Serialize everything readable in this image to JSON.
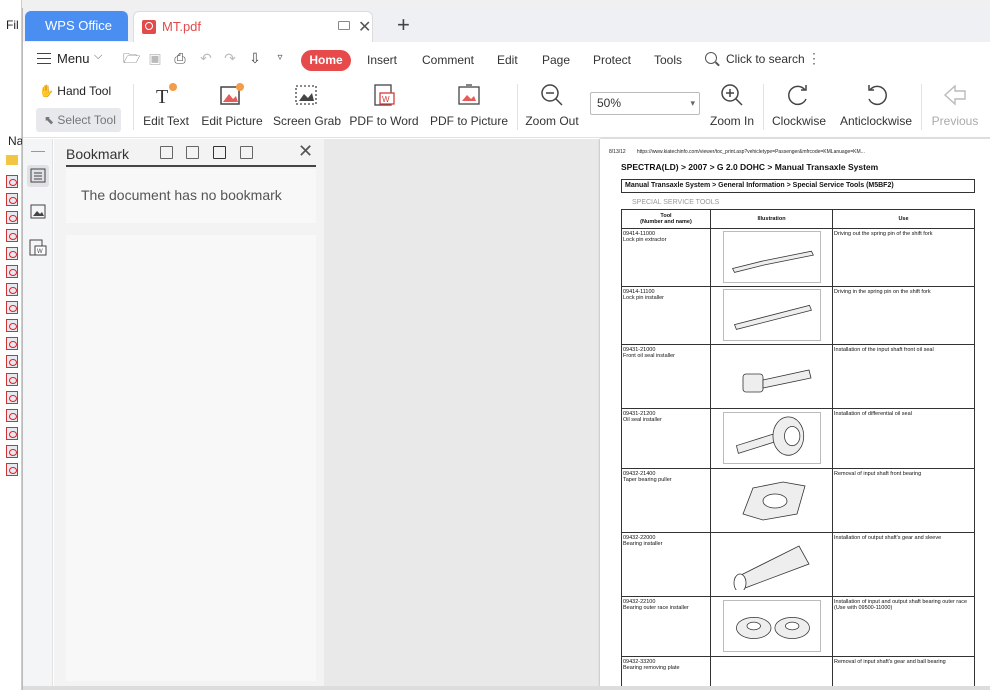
{
  "background_window": {
    "file_label": "Fil",
    "name_label": "Na"
  },
  "tabs": {
    "home_tab": "WPS Office",
    "doc_tab": "MT.pdf",
    "new_tab": "+"
  },
  "menubar": {
    "menu": "Menu",
    "items": [
      "Home",
      "Insert",
      "Comment",
      "Edit",
      "Page",
      "Protect",
      "Tools"
    ],
    "search": "Click to search"
  },
  "ribbon": {
    "hand_tool": "Hand Tool",
    "select_tool": "Select Tool",
    "edit_text": "Edit Text",
    "edit_picture": "Edit Picture",
    "screen_grab": "Screen Grab",
    "pdf_to_word": "PDF to Word",
    "pdf_to_picture": "PDF to Picture",
    "zoom_out": "Zoom Out",
    "zoom_value": "50%",
    "zoom_in": "Zoom In",
    "clockwise": "Clockwise",
    "anticlockwise": "Anticlockwise",
    "previous": "Previous"
  },
  "panel": {
    "title": "Bookmark",
    "empty_message": "The document has no bookmark"
  },
  "document": {
    "header_date": "8/13/12",
    "header_url": "https://www.kiatechinfo.com/viewer/toc_print.asp?vehicletype=Passenger&mfrcode=KMLanuage=KM...",
    "breadcrumb": "SPECTRA(LD) > 2007 > G 2.0 DOHC > Manual Transaxle System",
    "section": "Manual Transaxle System > General Information > Special Service Tools (M5BF2)",
    "subtitle": "SPECIAL SERVICE TOOLS",
    "columns": [
      "Tool\n(Number and name)",
      "Illustration",
      "Use"
    ],
    "rows": [
      {
        "num": "09414-11000",
        "name": "Lock pin extractor",
        "use": "Driving out the spring pin of the shift fork"
      },
      {
        "num": "09414-11100",
        "name": "Lock pin installer",
        "use": "Driving in the spring pin on the shift fork"
      },
      {
        "num": "09431-21000",
        "name": "Front oil seal installer",
        "use": "Installation of the input shaft front oil seal"
      },
      {
        "num": "09431-21200",
        "name": "Oil seal installer",
        "use": "Installation of differential oil seal"
      },
      {
        "num": "09432-21400",
        "name": "Taper bearing puller",
        "use": "Removal of input shaft front bearing"
      },
      {
        "num": "09432-22000",
        "name": "Bearing installer",
        "use": "Installation of output shaft's gear and sleeve"
      },
      {
        "num": "09432-22100",
        "name": "Bearing outer race installer",
        "use": "Installation of input and output shaft bearing outer race\n(Use with 09500-11000)"
      },
      {
        "num": "09432-33200",
        "name": "Bearing removing plate",
        "use": "Removal of input shaft's gear and ball bearing"
      }
    ]
  }
}
